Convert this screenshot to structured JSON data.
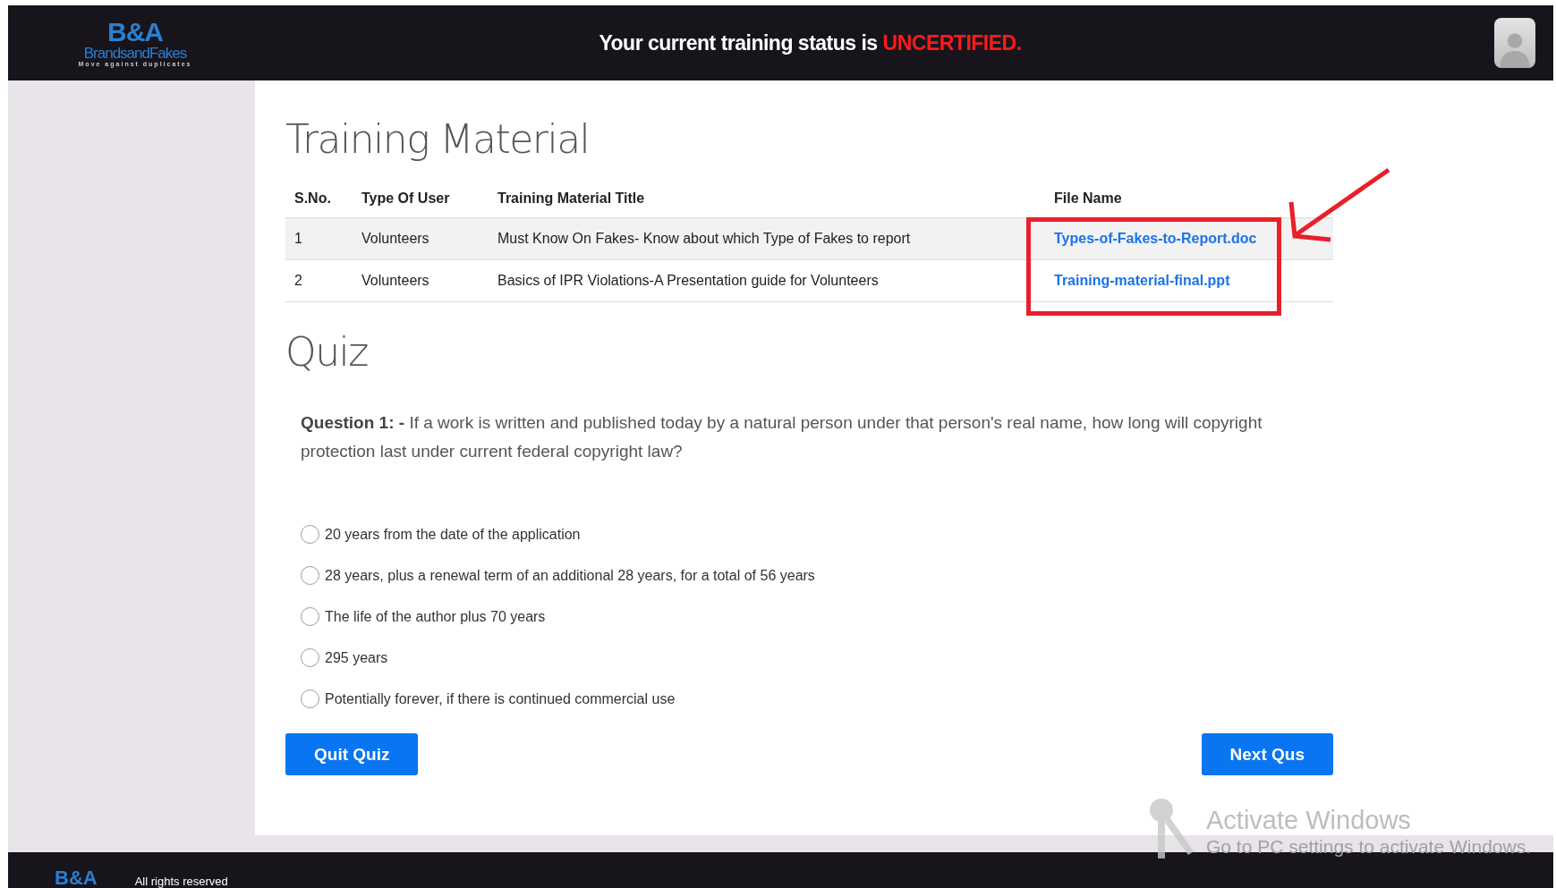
{
  "header": {
    "logo": {
      "mark": "B&A",
      "name": "BrandsandFakes",
      "tagline": "Move against duplicates"
    },
    "status_prefix": "Your current training status is ",
    "status_value": "UNCERTIFIED."
  },
  "training": {
    "title": "Training Material",
    "columns": [
      "S.No.",
      "Type Of User",
      "Training Material Title",
      "File Name"
    ],
    "rows": [
      {
        "cells": [
          "1",
          "Volunteers",
          "Must Know On Fakes- Know about which Type of Fakes to report",
          "Types-of-Fakes-to-Report.doc"
        ],
        "highlighted": true
      },
      {
        "cells": [
          "2",
          "Volunteers",
          "Basics of IPR Violations-A Presentation guide for Volunteers",
          "Training-material-final.ppt"
        ],
        "highlighted": false
      }
    ]
  },
  "quiz": {
    "title": "Quiz",
    "question_label": "Question 1: -",
    "question": "If a work is written and published today by a natural person under that person's real name, how long will copyright protection last under current federal copyright law?",
    "options": [
      {
        "label": "20 years from the date of the application",
        "selected": false
      },
      {
        "label": "28 years, plus a renewal term of an additional 28 years, for a total of 56 years",
        "selected": false
      },
      {
        "label": "The life of the author plus 70 years",
        "selected": false
      },
      {
        "label": "295 years",
        "selected": false
      },
      {
        "label": "Potentially forever, if there is continued commercial use",
        "selected": false
      }
    ],
    "buttons": [
      "Quit Quiz",
      "Next Qus"
    ]
  },
  "footer": {
    "logo_mark": "B&A",
    "text": "All rights reserved"
  },
  "os_notice": {
    "title": "Activate Windows",
    "text": "Go to PC settings to activate Windows."
  }
}
